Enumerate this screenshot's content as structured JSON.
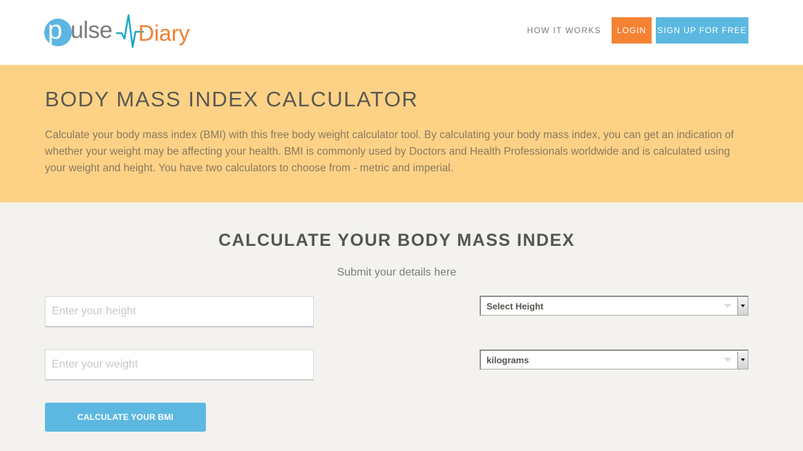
{
  "header": {
    "logo": {
      "part1_letter": "p",
      "part1_rest": "ulse",
      "part2": "Diary",
      "colors": {
        "circle": "#5bb6e2",
        "pulse_text": "#7a7a7a",
        "diary_text": "#f07f30",
        "heartbeat_line": "#1aa8c8"
      }
    },
    "nav": {
      "how_it_works": "HOW IT WORKS",
      "login": "LOGIN",
      "signup": "SIGN UP FOR FREE"
    }
  },
  "hero": {
    "title": "BODY MASS INDEX CALCULATOR",
    "description": "Calculate your body mass index (BMI) with this free body weight calculator tool. By calculating your body mass index, you can get an indication of whether your weight may be affecting your health. BMI is commonly used by Doctors and Health Professionals worldwide and is calculated using your weight and height. You have two calculators to choose from - metric and imperial."
  },
  "calculator": {
    "title": "CALCULATE YOUR BODY MASS INDEX",
    "subtitle": "Submit your details here",
    "height_input": {
      "placeholder": "Enter your height",
      "value": ""
    },
    "weight_input": {
      "placeholder": "Enter your weight",
      "value": ""
    },
    "height_unit_select": {
      "selected": "Select Height"
    },
    "weight_unit_select": {
      "selected": "kilograms"
    },
    "submit_label": "CALCULATE YOUR BMI"
  },
  "colors": {
    "accent_orange": "#f58233",
    "accent_blue": "#5cb8e1",
    "hero_bg": "#fdd286",
    "page_bg": "#f3f2ee"
  }
}
